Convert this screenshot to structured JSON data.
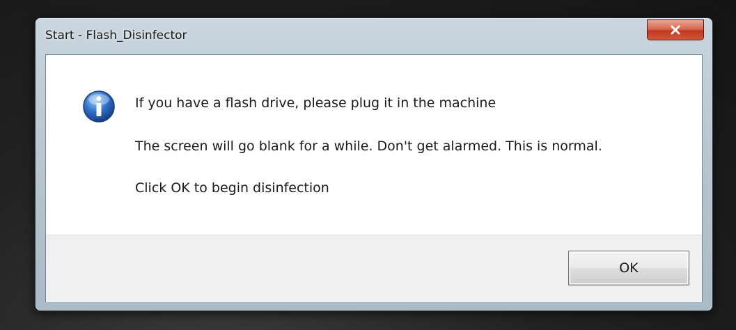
{
  "window": {
    "title": "Start - Flash_Disinfector",
    "close_icon": "close-icon"
  },
  "message": {
    "icon": "info-icon",
    "lines": [
      "If you have a flash drive, please plug it in the machine",
      "The screen will go blank for a while. Don't get alarmed. This is normal.",
      "Click OK to begin disinfection"
    ]
  },
  "buttons": {
    "ok_label": "OK"
  },
  "colors": {
    "close_red": "#c2381f",
    "info_blue": "#2f6fc9"
  }
}
